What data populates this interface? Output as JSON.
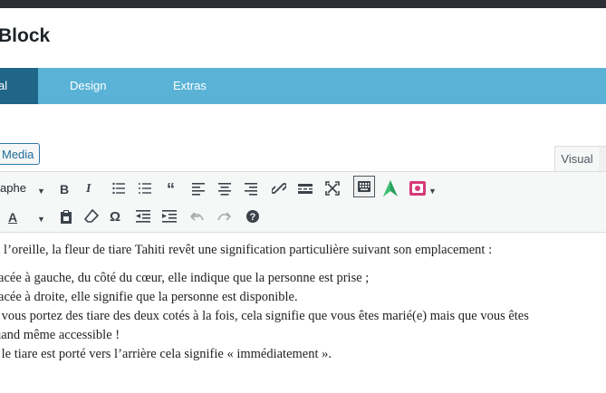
{
  "window": {
    "title": "Block"
  },
  "tabs": [
    {
      "label": "al"
    },
    {
      "label": "Design"
    },
    {
      "label": "Extras"
    }
  ],
  "editor": {
    "add_media_label": "Media",
    "visual_tab_label": "Visual",
    "format_select_value": "aphe",
    "paragraph": "à l’oreille, la fleur de tiare Tahiti revêt une signification particulière suivant son emplacement :",
    "list_items": [
      "lacée à gauche, du côté du cœur, elle indique que la personne est prise ;",
      "lacée à droite, elle signifie que la personne est disponible.",
      "i vous portez des tiare des deux cotés à la fois, cela signifie que vous êtes marié(e) mais que vous êtes",
      "uand même accessible !",
      "i le tiare est porté vers l’arrière cela signifie « immédiatement »."
    ]
  },
  "toolbar_icons": {
    "row1": [
      "dropdown-caret-icon",
      "bold-icon",
      "italic-icon",
      "bullet-list-icon",
      "numbered-list-icon",
      "blockquote-icon",
      "align-left-icon",
      "align-center-icon",
      "align-right-icon",
      "link-icon",
      "read-more-icon",
      "fullscreen-icon",
      "toolbar-toggle-icon",
      "leaf-icon",
      "media-plugin-icon"
    ],
    "row2": [
      "text-color-icon",
      "paste-text-icon",
      "clear-formatting-icon",
      "special-character-icon",
      "outdent-icon",
      "indent-icon",
      "undo-icon",
      "redo-icon",
      "help-icon"
    ]
  },
  "colors": {
    "tab_bar": "#5ab3d6",
    "active_tab": "#1f6688",
    "accent": "#1f6d9c"
  }
}
